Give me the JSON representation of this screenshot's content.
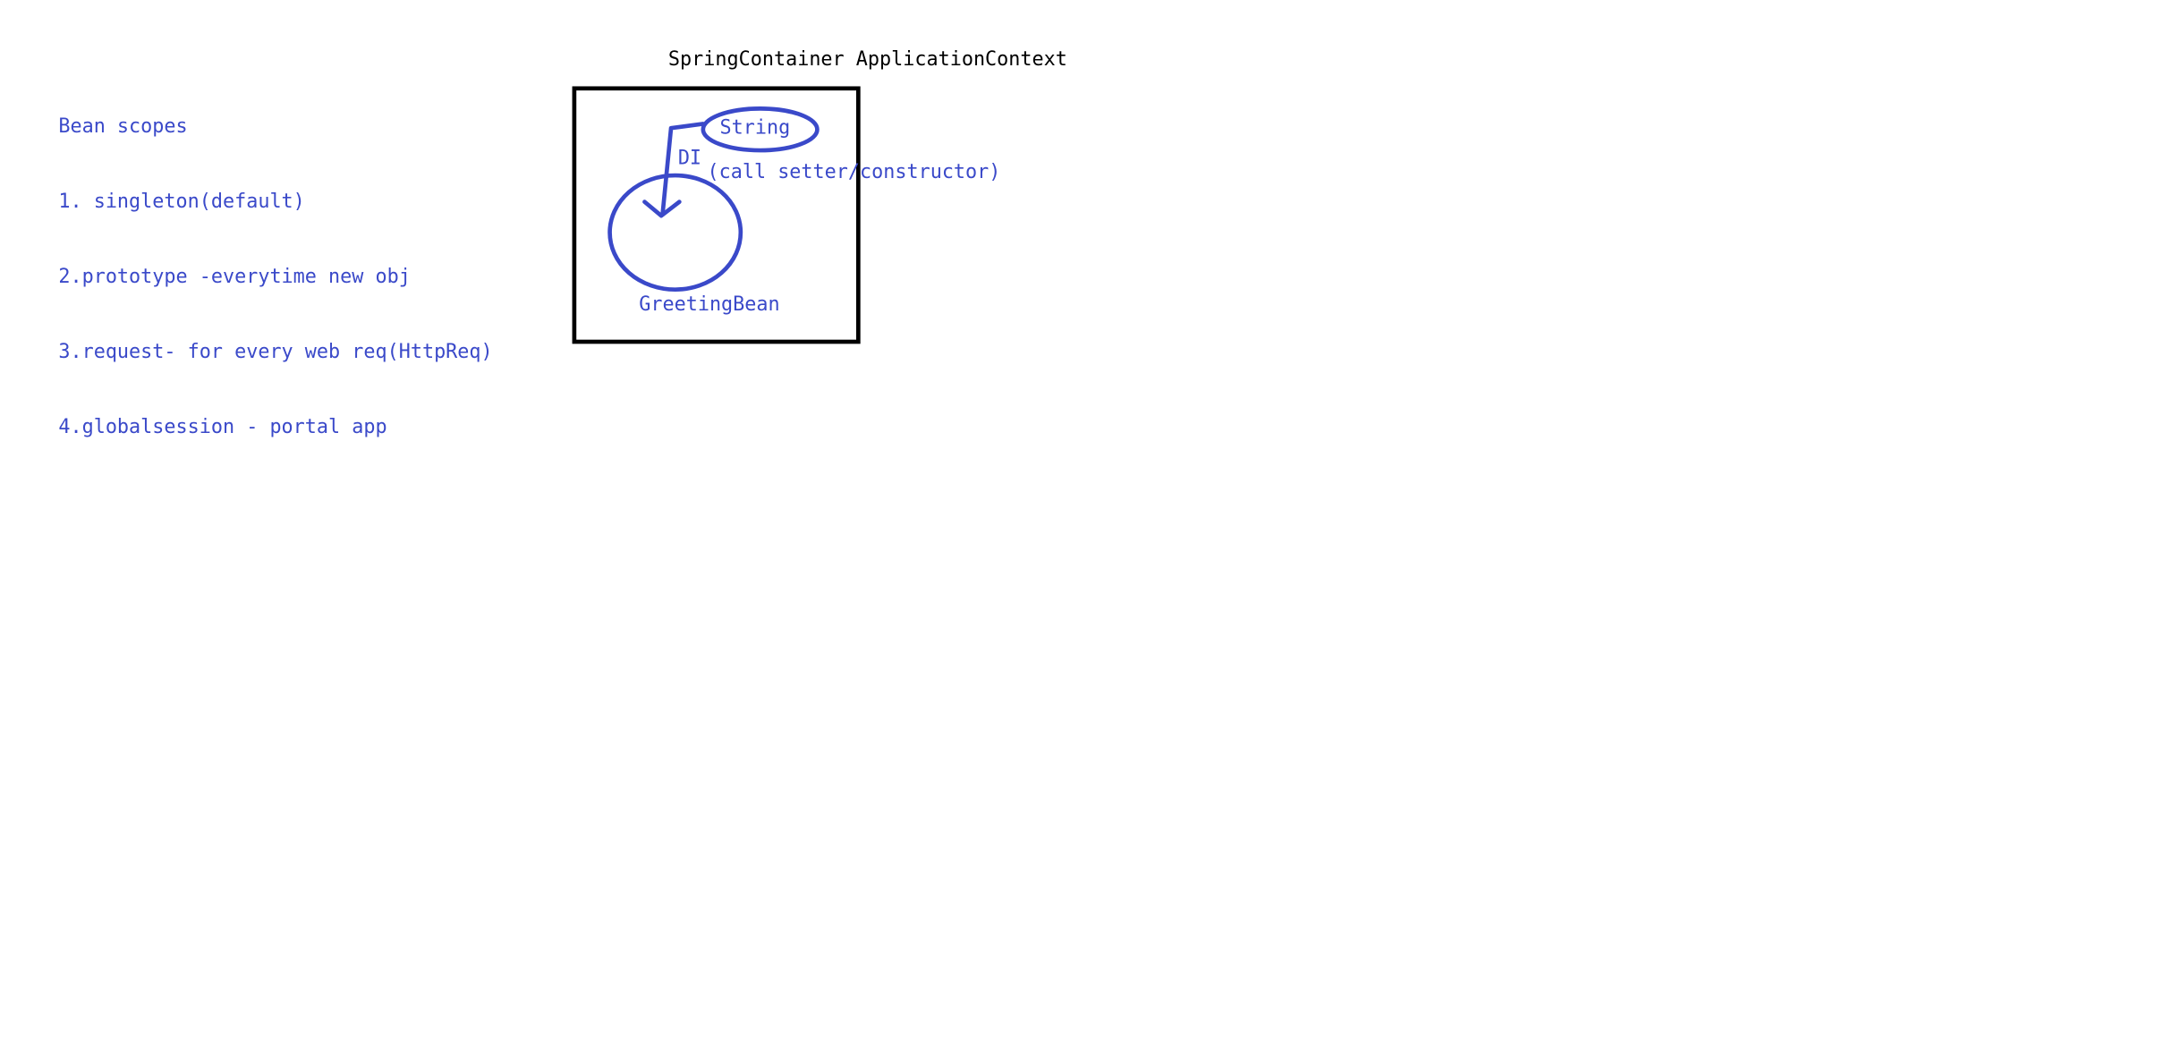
{
  "notes": {
    "heading": "Bean scopes",
    "items": [
      "1. singleton(default)",
      "2.prototype -everytime new obj",
      "3.request- for every web req(HttpReq)",
      "4.globalsession - portal app"
    ]
  },
  "diagram": {
    "container_title": "SpringContainer ApplicationContext",
    "string_node": "String",
    "arrow_label": "DI",
    "injection_note": "(call setter/constructor)",
    "bean_node": "GreetingBean"
  },
  "colors": {
    "ink_blue": "#3a49c9",
    "ink_black": "#000000",
    "background": "#ffffff"
  }
}
